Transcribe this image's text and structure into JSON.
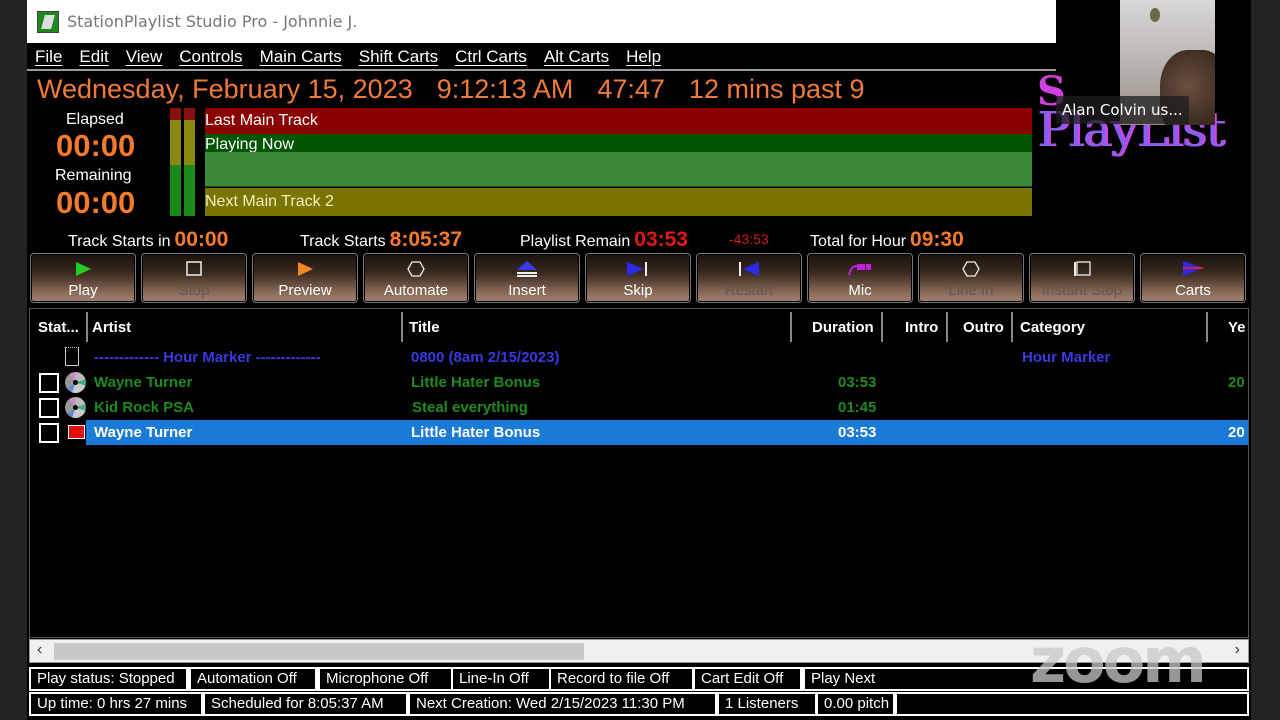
{
  "window": {
    "title": "StationPlaylist Studio Pro - Johnnie J."
  },
  "menu": [
    "File",
    "Edit",
    "View",
    "Controls",
    "Main Carts",
    "Shift Carts",
    "Ctrl Carts",
    "Alt Carts",
    "Help"
  ],
  "clock": {
    "date": "Wednesday, February 15, 2023",
    "time": "9:12:13 AM",
    "countdown": "47:47",
    "phrase": "12 mins past 9"
  },
  "timers": {
    "elapsed_label": "Elapsed",
    "elapsed": "00:00",
    "remaining_label": "Remaining",
    "remaining": "00:00"
  },
  "track_bars": {
    "last_main": "Last Main Track",
    "playing_now": "Playing Now",
    "next_main": "Next Main Track 2",
    "colors": {
      "last": "#8a0000",
      "playing": "#005500",
      "playing_fill": "#3a8a3a",
      "next": "#7a7400"
    }
  },
  "logo": {
    "text": "PlayList"
  },
  "info": {
    "track_starts_in_label": "Track Starts in",
    "track_starts_in": "00:00",
    "track_starts_label": "Track Starts",
    "track_starts": "8:05:37",
    "playlist_remain_label": "Playlist Remain",
    "playlist_remain": "03:53",
    "playlist_remain_neg": "-43:53",
    "total_hour_label": "Total for Hour",
    "total_hour": "09:30"
  },
  "toolbar": [
    {
      "label": "Play",
      "icon": "play-icon",
      "enabled": true
    },
    {
      "label": "Stop",
      "icon": "stop-icon",
      "enabled": false
    },
    {
      "label": "Preview",
      "icon": "preview-icon",
      "enabled": true
    },
    {
      "label": "Automate",
      "icon": "automate-icon",
      "enabled": true
    },
    {
      "label": "Insert",
      "icon": "insert-icon",
      "enabled": true
    },
    {
      "label": "Skip",
      "icon": "skip-icon",
      "enabled": true
    },
    {
      "label": "Restart",
      "icon": "restart-icon",
      "enabled": false
    },
    {
      "label": "Mic",
      "icon": "mic-icon",
      "enabled": true
    },
    {
      "label": "Line In",
      "icon": "line-in-icon",
      "enabled": false
    },
    {
      "label": "Instant Stop",
      "icon": "instant-stop-icon",
      "enabled": false
    },
    {
      "label": "Carts",
      "icon": "carts-icon",
      "enabled": true
    }
  ],
  "playlist": {
    "columns": [
      "Stat...",
      "Artist",
      "Title",
      "Duration",
      "Intro",
      "Outro",
      "Category",
      "Ye"
    ],
    "rows": [
      {
        "type": "marker",
        "artist": "------------- Hour Marker -------------",
        "title": "0800 (8am 2/15/2023)",
        "duration": "",
        "category": "Hour Marker",
        "year": ""
      },
      {
        "type": "track",
        "artist": "Wayne Turner",
        "title": "Little Hater Bonus",
        "duration": "03:53",
        "category": "",
        "year": "20"
      },
      {
        "type": "track",
        "artist": "Kid Rock PSA",
        "title": "Steal everything",
        "duration": "01:45",
        "category": "",
        "year": ""
      },
      {
        "type": "selected",
        "artist": "Wayne Turner",
        "title": "Little Hater Bonus",
        "duration": "03:53",
        "category": "",
        "year": "20"
      }
    ]
  },
  "status_bar_1": [
    "Play status: Stopped",
    "Automation Off",
    "Microphone Off",
    "Line-In Off",
    "Record to file Off",
    "Cart Edit Off",
    "Play Next"
  ],
  "status_bar_2": [
    "Up time: 0 hrs 27 mins",
    "Scheduled for 8:05:37 AM",
    "Next Creation: Wed 2/15/2023 11:30 PM",
    "1 Listeners",
    "0.00 pitch",
    ""
  ],
  "overlay": {
    "participant_name": "Alan Colvin us...",
    "watermark": "zoom"
  }
}
